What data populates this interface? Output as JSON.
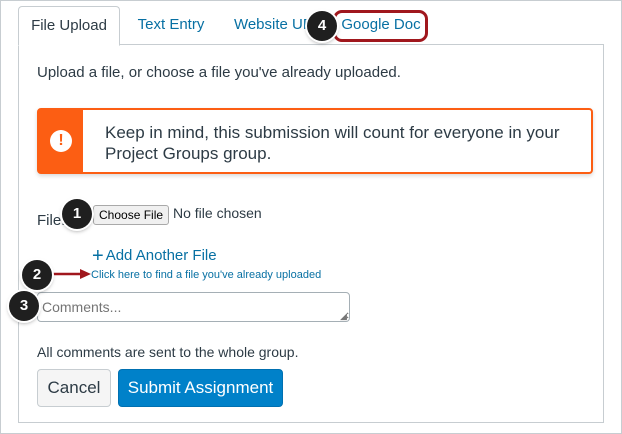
{
  "tabs": [
    {
      "label": "File Upload",
      "active": true
    },
    {
      "label": "Text Entry",
      "active": false
    },
    {
      "label": "Website URL",
      "active": false
    },
    {
      "label": "Google Doc",
      "active": false
    }
  ],
  "intro_text": "Upload a file, or choose a file you've already uploaded.",
  "alert": {
    "icon": "exclamation-icon",
    "line1": "Keep in mind, this submission will count for everyone in your",
    "line2": "Project Groups group.",
    "color": "#fc5e13"
  },
  "file": {
    "label": "File:",
    "choose_button": "Choose File",
    "status": "No file chosen"
  },
  "add_file_link": "Add Another File",
  "find_file_link": "Click here to find a file you've already uploaded",
  "comments": {
    "value": "",
    "placeholder": "Comments..."
  },
  "group_note": "All comments are sent to the whole group.",
  "buttons": {
    "cancel": "Cancel",
    "submit": "Submit Assignment"
  },
  "callouts": [
    "1",
    "2",
    "3",
    "4"
  ],
  "colors": {
    "link": "#0770a3",
    "submit": "#0081c9",
    "highlight": "#a0171d"
  }
}
